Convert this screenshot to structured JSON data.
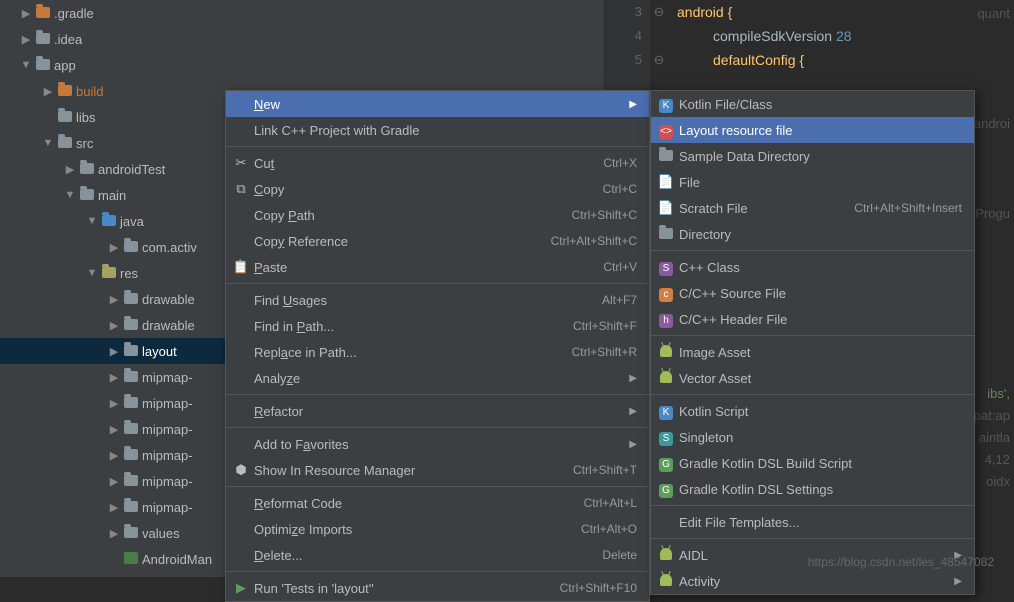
{
  "tree": {
    "gradle": ".gradle",
    "idea": ".idea",
    "app": "app",
    "build": "build",
    "libs": "libs",
    "src": "src",
    "androidTest": "androidTest",
    "main": "main",
    "java": "java",
    "comactiv": "com.activ",
    "res": "res",
    "drawable1": "drawable",
    "drawable2": "drawable",
    "layout": "layout",
    "mipmap1": "mipmap-",
    "mipmap2": "mipmap-",
    "mipmap3": "mipmap-",
    "mipmap4": "mipmap-",
    "mipmap5": "mipmap-",
    "mipmap6": "mipmap-",
    "values": "values",
    "manifest": "AndroidMan"
  },
  "editor": {
    "line3_num": "3",
    "line3_code": "android {",
    "line4_num": "4",
    "line4_code_a": "compileSdkVersion ",
    "line4_code_b": "28",
    "line5_num": "5",
    "line5_code": "defaultConfig {",
    "ghost1": "quant",
    "ghost2": "androi",
    "ghost3": "EProgu",
    "ghost4": "ibs',",
    "ghost5": "pat:ap",
    "ghost6": "aintla",
    "ghost7": "4,12",
    "ghost8": "oidx"
  },
  "menu": {
    "new": "New",
    "linkcpp": "Link C++ Project with Gradle",
    "cut": "Cut",
    "cut_sc": "Ctrl+X",
    "copy": "Copy",
    "copy_sc": "Ctrl+C",
    "copypath": "Copy Path",
    "copypath_sc": "Ctrl+Shift+C",
    "copyref": "Copy Reference",
    "copyref_sc": "Ctrl+Alt+Shift+C",
    "paste": "Paste",
    "paste_sc": "Ctrl+V",
    "findusages": "Find Usages",
    "findusages_sc": "Alt+F7",
    "findinpath": "Find in Path...",
    "findinpath_sc": "Ctrl+Shift+F",
    "replaceinpath": "Replace in Path...",
    "replaceinpath_sc": "Ctrl+Shift+R",
    "analyze": "Analyze",
    "refactor": "Refactor",
    "addtofav": "Add to Favorites",
    "showres": "Show In Resource Manager",
    "showres_sc": "Ctrl+Shift+T",
    "reformat": "Reformat Code",
    "reformat_sc": "Ctrl+Alt+L",
    "optimize": "Optimize Imports",
    "optimize_sc": "Ctrl+Alt+O",
    "delete": "Delete...",
    "delete_sc": "Delete",
    "runtests": "Run 'Tests in 'layout''",
    "runtests_sc": "Ctrl+Shift+F10"
  },
  "sub": {
    "kotlin": "Kotlin File/Class",
    "layout": "Layout resource file",
    "sampledata": "Sample Data Directory",
    "file": "File",
    "scratch": "Scratch File",
    "scratch_sc": "Ctrl+Alt+Shift+Insert",
    "directory": "Directory",
    "cppclass": "C++ Class",
    "cppsource": "C/C++ Source File",
    "cppheader": "C/C++ Header File",
    "imgasset": "Image Asset",
    "vecasset": "Vector Asset",
    "kotlinscript": "Kotlin Script",
    "singleton": "Singleton",
    "gradlebuild": "Gradle Kotlin DSL Build Script",
    "gradlesettings": "Gradle Kotlin DSL Settings",
    "editfile": "Edit File Templates...",
    "aidl": "AIDL",
    "activity": "Activity"
  },
  "watermark": "https://blog.csdn.net/les_48547082"
}
